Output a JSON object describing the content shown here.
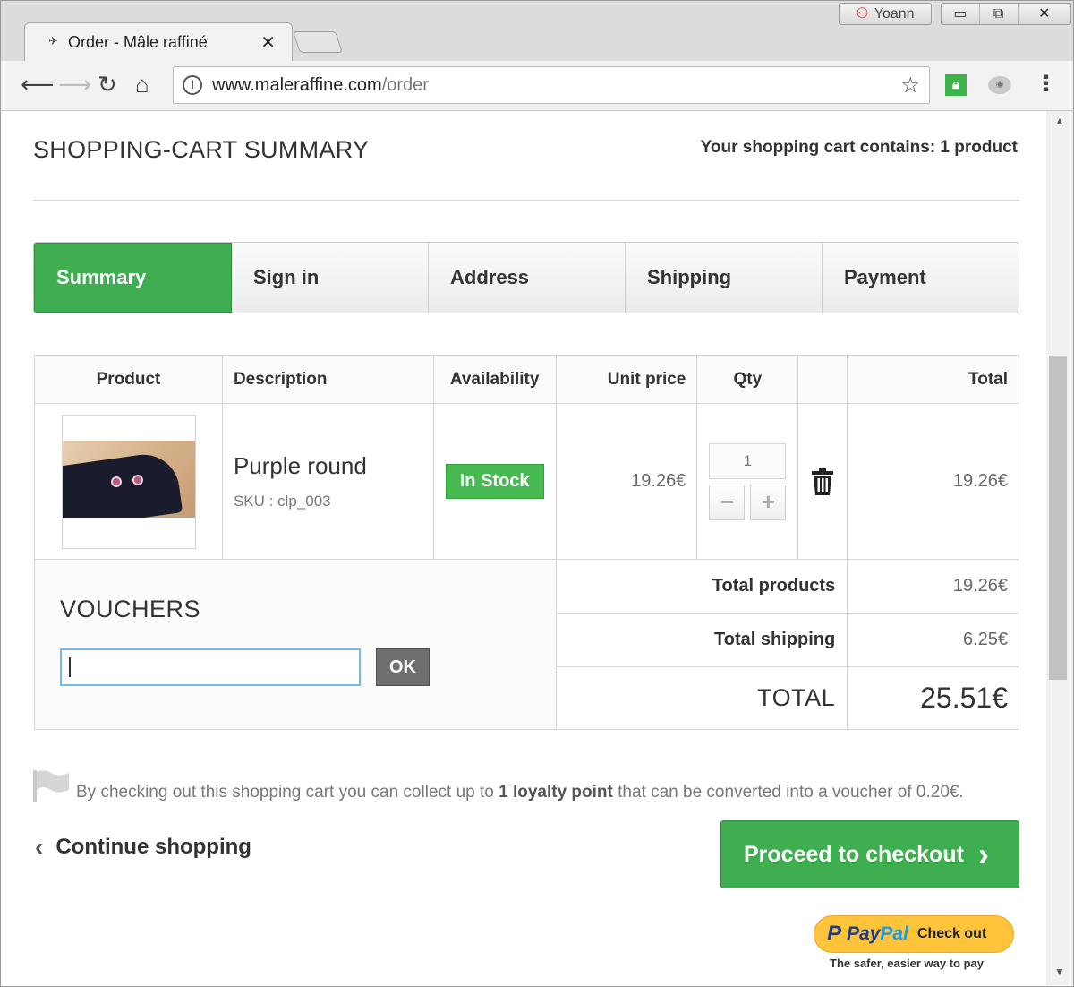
{
  "browser": {
    "tab_title": "Order - Mâle raffiné",
    "tab_close": "✕",
    "user_name": "Yoann",
    "url_domain": "www.maleraffine.com",
    "url_path": "/order",
    "window_controls": [
      "▭",
      "⧉",
      "✕"
    ]
  },
  "page": {
    "title": "SHOPPING-CART SUMMARY",
    "cart_count_text": "Your shopping cart contains: 1 product"
  },
  "steps": [
    {
      "label": "Summary",
      "active": true
    },
    {
      "label": "Sign in",
      "active": false
    },
    {
      "label": "Address",
      "active": false
    },
    {
      "label": "Shipping",
      "active": false
    },
    {
      "label": "Payment",
      "active": false
    }
  ],
  "cart": {
    "headers": {
      "product": "Product",
      "description": "Description",
      "availability": "Availability",
      "unit_price": "Unit price",
      "qty": "Qty",
      "delete": "",
      "total": "Total"
    },
    "item": {
      "name": "Purple round",
      "sku": "SKU : clp_003",
      "availability": "In Stock",
      "unit_price": "19.26€",
      "qty": "1",
      "minus": "−",
      "plus": "+",
      "total": "19.26€"
    },
    "summary": {
      "total_products_label": "Total products",
      "total_products": "19.26€",
      "total_shipping_label": "Total shipping",
      "total_shipping": "6.25€",
      "total_label": "TOTAL",
      "total": "25.51€"
    }
  },
  "vouchers": {
    "title": "VOUCHERS",
    "input_value": "",
    "ok_label": "OK"
  },
  "loyalty": {
    "prefix": "By checking out this shopping cart you can collect up to",
    "points": "1 loyalty point",
    "suffix": "that can be converted into a voucher of 0.20€."
  },
  "actions": {
    "continue_label": "Continue shopping",
    "checkout_label": "Proceed to checkout"
  },
  "paypal": {
    "pay": "Pay",
    "pal": "Pal",
    "check_out": "Check out",
    "tagline": "The safer, easier way to pay"
  },
  "colors": {
    "accent_green": "#3eae50",
    "paypal_yellow": "#ffc43a",
    "paypal_blue": "#1d3c8a"
  },
  "icons": {
    "back": "arrow-left-icon",
    "forward": "arrow-right-icon",
    "reload": "reload-icon",
    "home": "home-icon",
    "info": "info-icon",
    "star": "star-icon",
    "trash": "trash-icon",
    "flag": "flag-icon",
    "chevron_left": "chevron-left-icon",
    "chevron_right": "chevron-right-icon"
  }
}
